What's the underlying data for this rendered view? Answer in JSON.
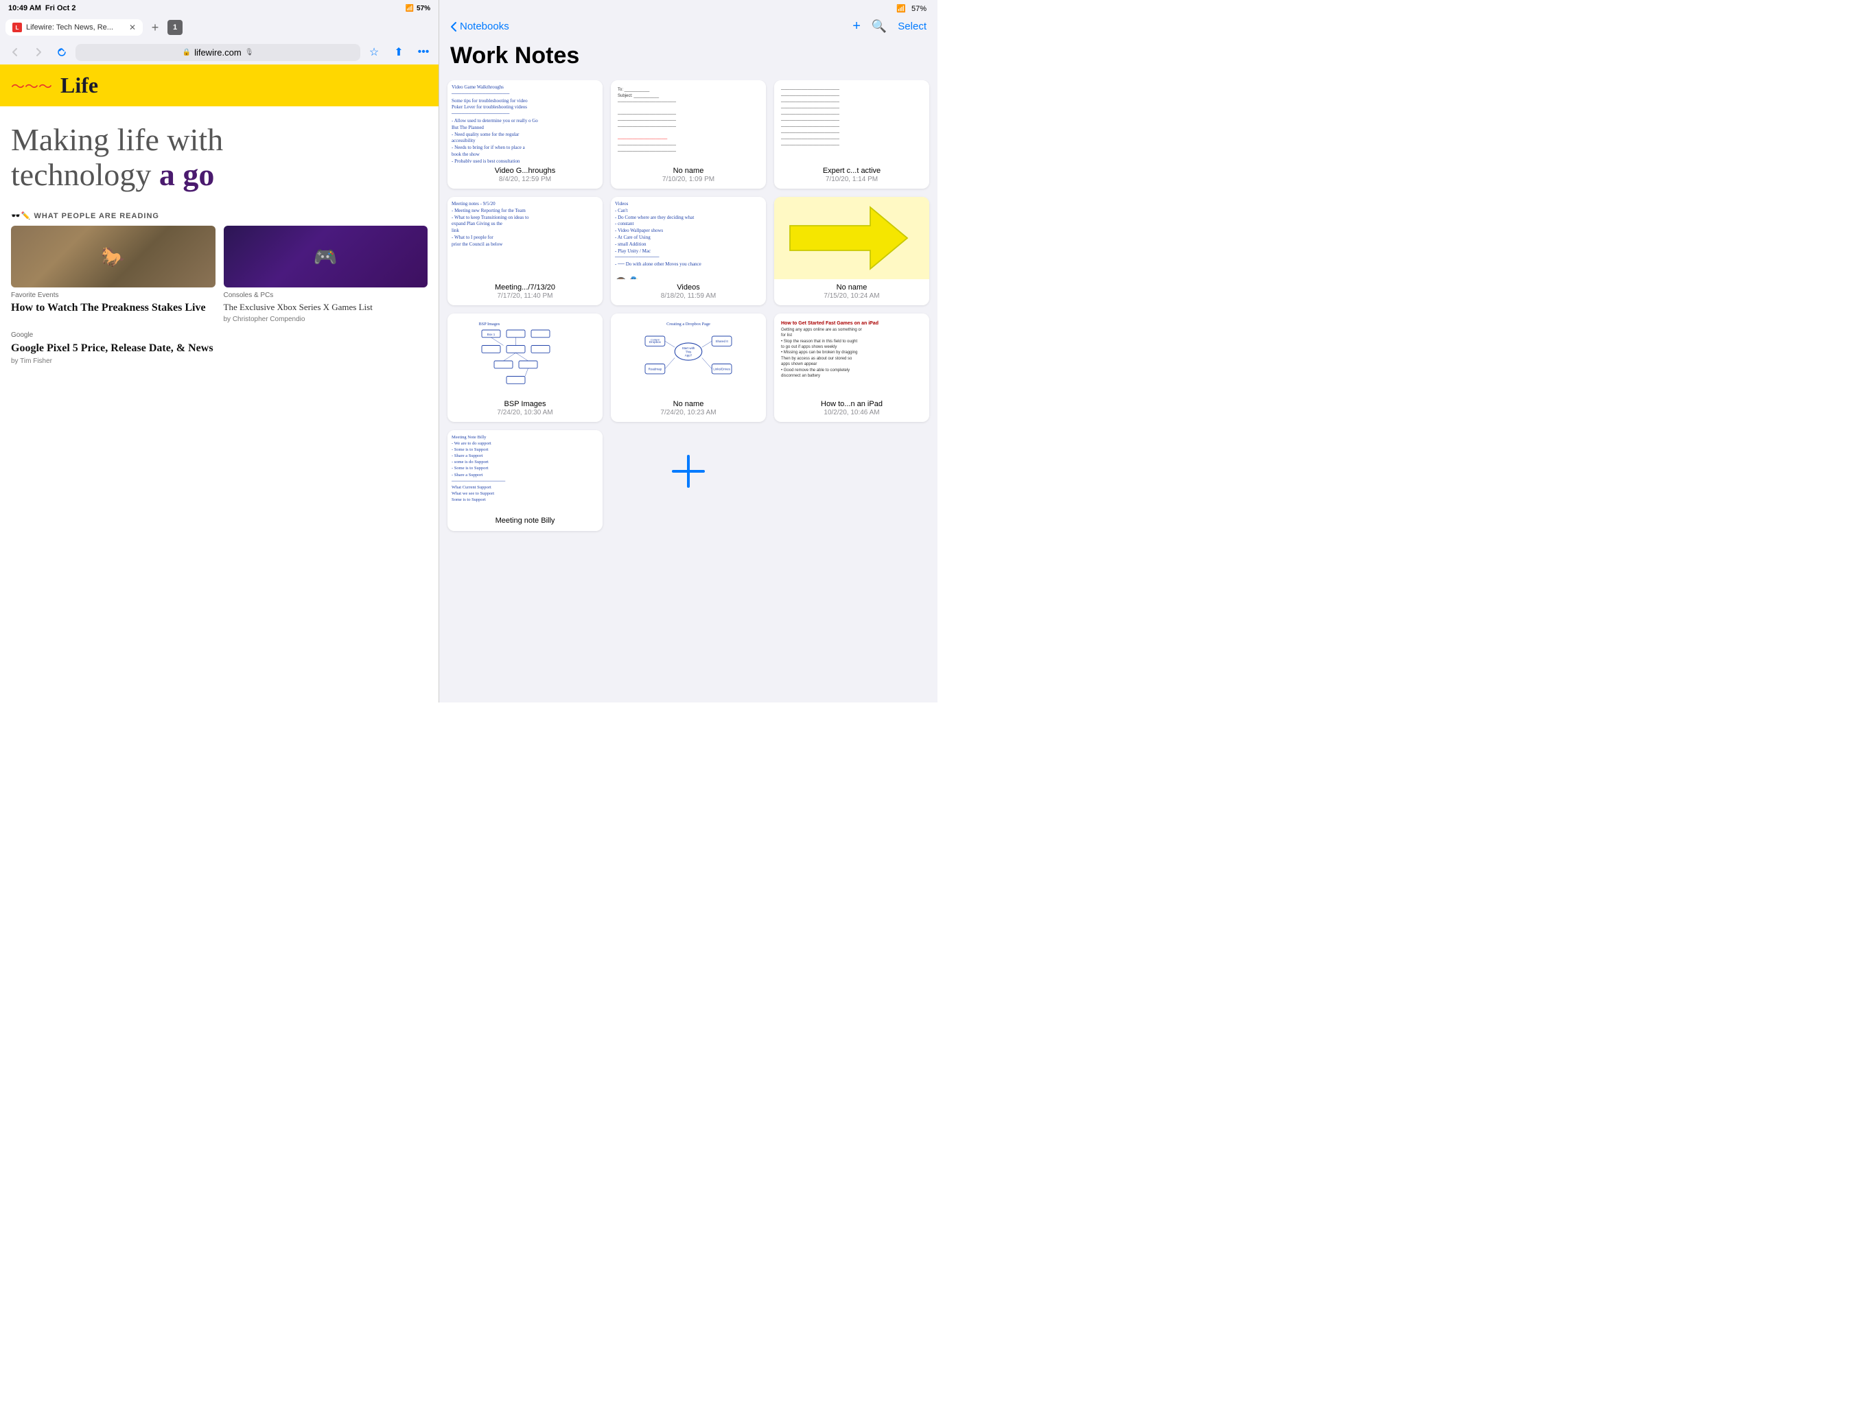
{
  "status_bar": {
    "time": "10:49 AM",
    "date": "Fri Oct 2",
    "battery": "57%",
    "wifi": true
  },
  "browser": {
    "tab_title": "Lifewire: Tech News, Re...",
    "tab_count": "1",
    "url": "lifewire.com",
    "back_label": "‹",
    "forward_label": "›",
    "reload_label": "↻",
    "hero_text_line1": "Making life with",
    "hero_text_line2": "technology",
    "hero_text_bold": "a go",
    "section_label": "🕶️✏️  WHAT PEOPLE ARE READING",
    "articles": [
      {
        "category": "Favorite Events",
        "title": "How to Watch The Preakness Stakes Live",
        "img_type": "horse"
      },
      {
        "category": "Consoles & PCs",
        "title": "The Exclusive Xbox Series X Games List",
        "byline": "by Christopher Compendio",
        "img_type": "gaming"
      },
      {
        "category": "Google",
        "title": "Google Pixel 5 Price, Release Date, & News",
        "byline": "by Tim Fisher",
        "img_type": "none"
      }
    ]
  },
  "notes": {
    "back_label": "Notebooks",
    "title": "Work Notes",
    "select_label": "Select",
    "add_label": "+",
    "search_label": "⌕",
    "notes": [
      {
        "id": "note1",
        "name": "Video G...hroughs",
        "date": "8/4/20, 12:59 PM",
        "type": "handwritten_list"
      },
      {
        "id": "note2",
        "name": "No name",
        "date": "7/10/20, 1:09 PM",
        "type": "printed_text"
      },
      {
        "id": "note3",
        "name": "Expert c...t active",
        "date": "7/10/20, 1:14 PM",
        "type": "printed_text2"
      },
      {
        "id": "note4",
        "name": "Meeting.../7/13/20",
        "date": "7/17/20, 11:40 PM",
        "type": "handwritten_meeting"
      },
      {
        "id": "note5",
        "name": "Videos",
        "date": "8/18/20, 11:59 AM",
        "type": "handwritten_video"
      },
      {
        "id": "note6",
        "name": "No name",
        "date": "7/15/20, 10:24 AM",
        "type": "arrow_yellow"
      },
      {
        "id": "note7",
        "name": "BSP Images",
        "date": "7/24/20, 10:30 AM",
        "type": "diagram"
      },
      {
        "id": "note8",
        "name": "No name",
        "date": "7/24/20, 10:23 AM",
        "type": "diagram2"
      },
      {
        "id": "note9",
        "name": "How to...n an iPad",
        "date": "10/2/20, 10:46 AM",
        "type": "bulleted_list"
      },
      {
        "id": "note10",
        "name": "Meeting note Billy",
        "date": "",
        "type": "handwritten_list2"
      },
      {
        "id": "note11",
        "name": "",
        "date": "",
        "type": "plus"
      }
    ]
  }
}
